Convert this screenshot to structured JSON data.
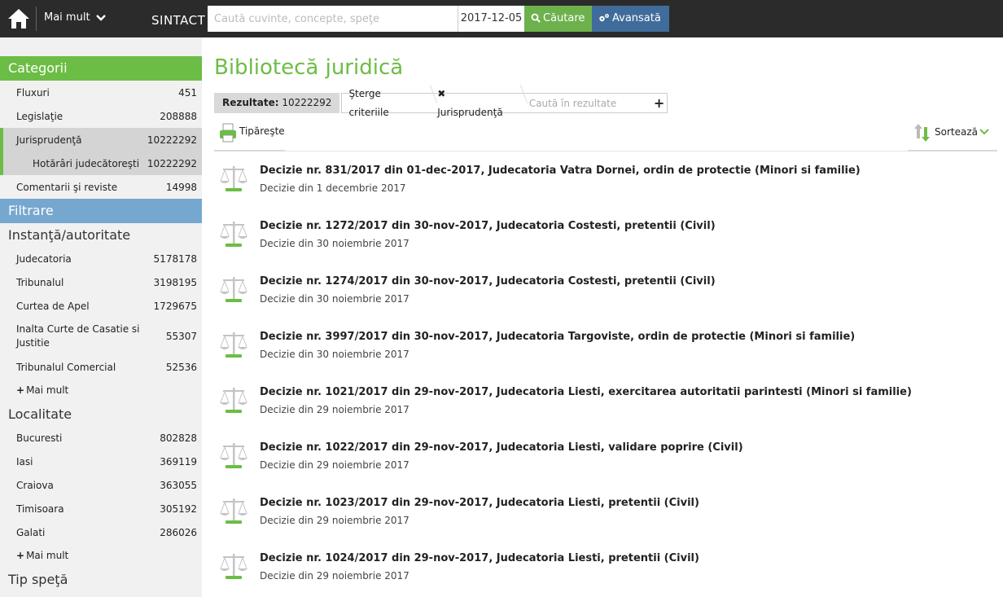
{
  "header": {
    "more_label": "Mai mult",
    "brand": "SINTACT",
    "search_placeholder": "Caută cuvinte, concepte, speţe",
    "date": "2017-12-05",
    "search_button": "Căutare",
    "advanced_button": "Avansată"
  },
  "sidebar": {
    "categories_title": "Categorii",
    "categories": [
      {
        "label": "Fluxuri",
        "count": "451"
      },
      {
        "label": "Legislaţie",
        "count": "208888"
      },
      {
        "label": "Jurisprudenţă",
        "count": "10222292"
      },
      {
        "label": "Hotărâri judecătoreşti",
        "count": "10222292"
      },
      {
        "label": "Comentarii şi reviste",
        "count": "14998"
      }
    ],
    "filter_title": "Filtrare",
    "group1_title": "Instanţă/autoritate",
    "group1": [
      {
        "label": "Judecatoria",
        "count": "5178178"
      },
      {
        "label": "Tribunalul",
        "count": "3198195"
      },
      {
        "label": "Curtea de Apel",
        "count": "1729675"
      },
      {
        "label": "Inalta Curte de Casatie si Justitie",
        "count": "55307"
      },
      {
        "label": "Tribunalul Comercial",
        "count": "52536"
      }
    ],
    "more_link": "Mai mult",
    "group2_title": "Localitate",
    "group2": [
      {
        "label": "Bucuresti",
        "count": "802828"
      },
      {
        "label": "Iasi",
        "count": "369119"
      },
      {
        "label": "Craiova",
        "count": "363055"
      },
      {
        "label": "Timisoara",
        "count": "305192"
      },
      {
        "label": "Galati",
        "count": "286026"
      }
    ],
    "group3_title": "Tip speţă"
  },
  "main": {
    "title": "Bibliotecă juridică",
    "results_label": "Rezultate:",
    "results_count": "10222292",
    "clear_criteria": "Şterge criteriile",
    "filter_tag": "Jurisprudenţă",
    "search_in_results_placeholder": "Caută în rezultate",
    "print_label": "Tipăreşte",
    "sort_label": "Sortează",
    "results": [
      {
        "title": "Decizie nr. 831/2017 din 01-dec-2017, Judecatoria Vatra Dornei, ordin de protectie (Minori si familie)",
        "date": "Decizie din 1 decembrie 2017"
      },
      {
        "title": "Decizie nr. 1272/2017 din 30-nov-2017, Judecatoria Costesti, pretentii (Civil)",
        "date": "Decizie din 30 noiembrie 2017"
      },
      {
        "title": "Decizie nr. 1274/2017 din 30-nov-2017, Judecatoria Costesti, pretentii (Civil)",
        "date": "Decizie din 30 noiembrie 2017"
      },
      {
        "title": "Decizie nr. 3997/2017 din 30-nov-2017, Judecatoria Targoviste, ordin de protectie (Minori si familie)",
        "date": "Decizie din 30 noiembrie 2017"
      },
      {
        "title": "Decizie nr. 1021/2017 din 29-nov-2017, Judecatoria Liesti, exercitarea autoritatii parintesti (Minori si familie)",
        "date": "Decizie din 29 noiembrie 2017"
      },
      {
        "title": "Decizie nr. 1022/2017 din 29-nov-2017, Judecatoria Liesti, validare poprire (Civil)",
        "date": "Decizie din 29 noiembrie 2017"
      },
      {
        "title": "Decizie nr. 1023/2017 din 29-nov-2017, Judecatoria Liesti, pretentii (Civil)",
        "date": "Decizie din 29 noiembrie 2017"
      },
      {
        "title": "Decizie nr. 1024/2017 din 29-nov-2017, Judecatoria Liesti, pretentii (Civil)",
        "date": "Decizie din 29 noiembrie 2017"
      }
    ]
  },
  "colors": {
    "accent_green": "#6cbd45",
    "filter_blue": "#76a7cf",
    "advanced_blue": "#3f6c9a",
    "topbar": "#2b2b2b"
  }
}
